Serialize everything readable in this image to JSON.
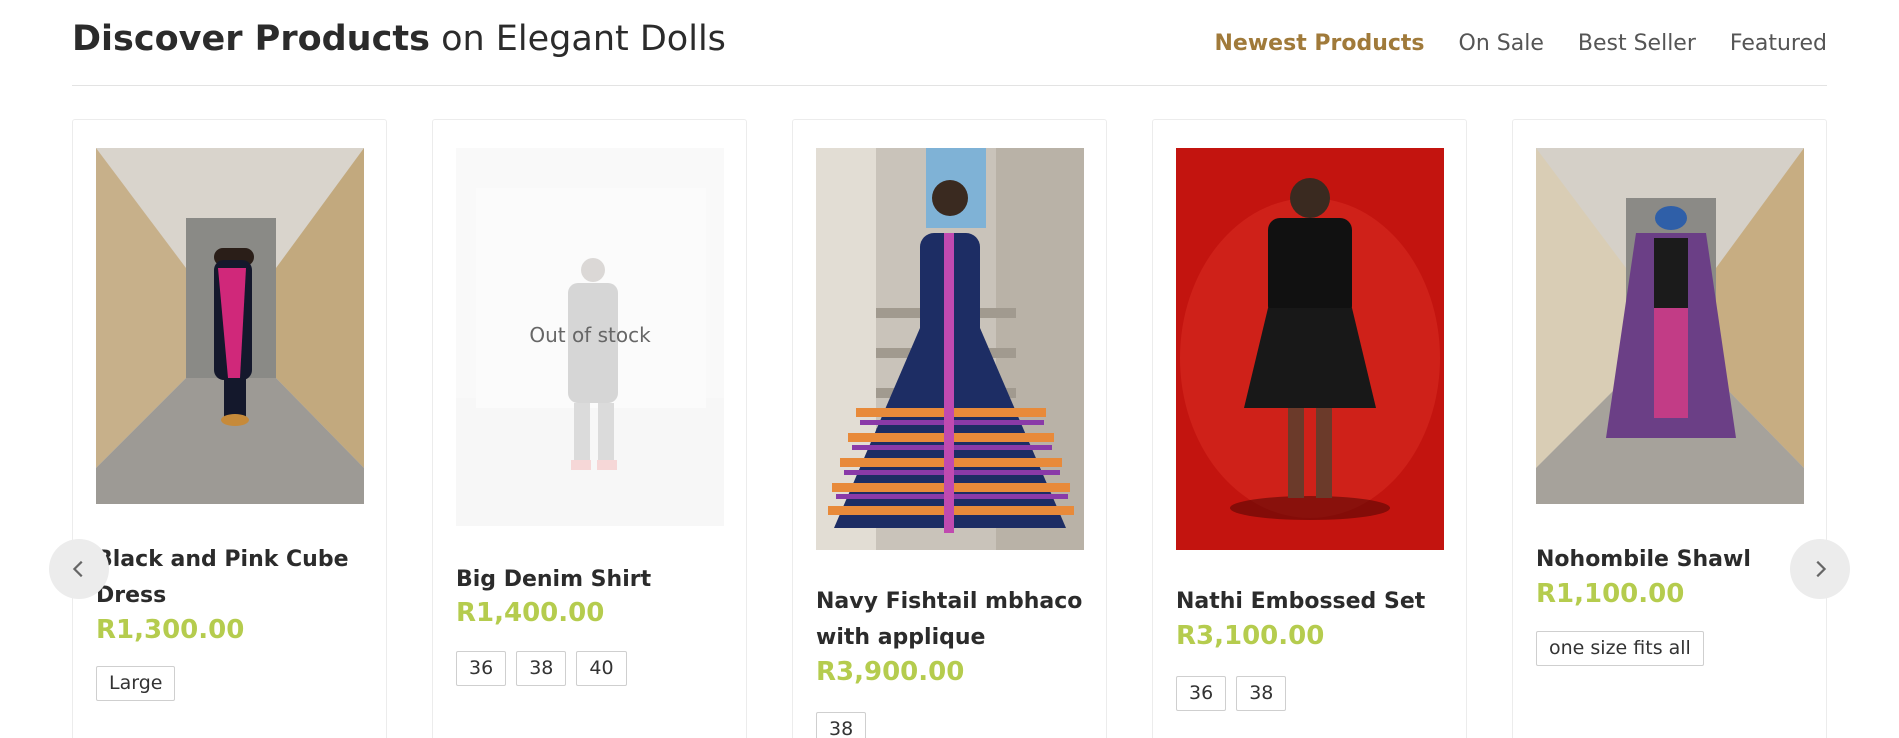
{
  "header": {
    "title_bold": "Discover Products",
    "title_rest": "on Elegant Dolls",
    "tabs": [
      {
        "label": "Newest Products",
        "active": true
      },
      {
        "label": "On Sale",
        "active": false
      },
      {
        "label": "Best Seller",
        "active": false
      },
      {
        "label": "Featured",
        "active": false
      }
    ]
  },
  "theme": {
    "accent": "#a07a3a",
    "price": "#b5cc4e"
  },
  "products": [
    {
      "name": "Black and Pink Cube Dress",
      "price": "R1,300.00",
      "sizes": [
        "Large"
      ],
      "out_of_stock": false
    },
    {
      "name": "Big Denim Shirt",
      "price": "R1,400.00",
      "sizes": [
        "36",
        "38",
        "40"
      ],
      "out_of_stock": true,
      "oos_label": "Out of stock"
    },
    {
      "name": "Navy Fishtail mbhaco with applique",
      "price": "R3,900.00",
      "sizes": [
        "38"
      ],
      "out_of_stock": false
    },
    {
      "name": "Nathi Embossed Set",
      "price": "R3,100.00",
      "sizes": [
        "36",
        "38"
      ],
      "out_of_stock": false
    },
    {
      "name": "Nohombile Shawl",
      "price": "R1,100.00",
      "sizes": [
        "one size fits all"
      ],
      "out_of_stock": false
    }
  ],
  "carousel": {
    "prev_icon": "chevron-left-icon",
    "next_icon": "chevron-right-icon"
  }
}
